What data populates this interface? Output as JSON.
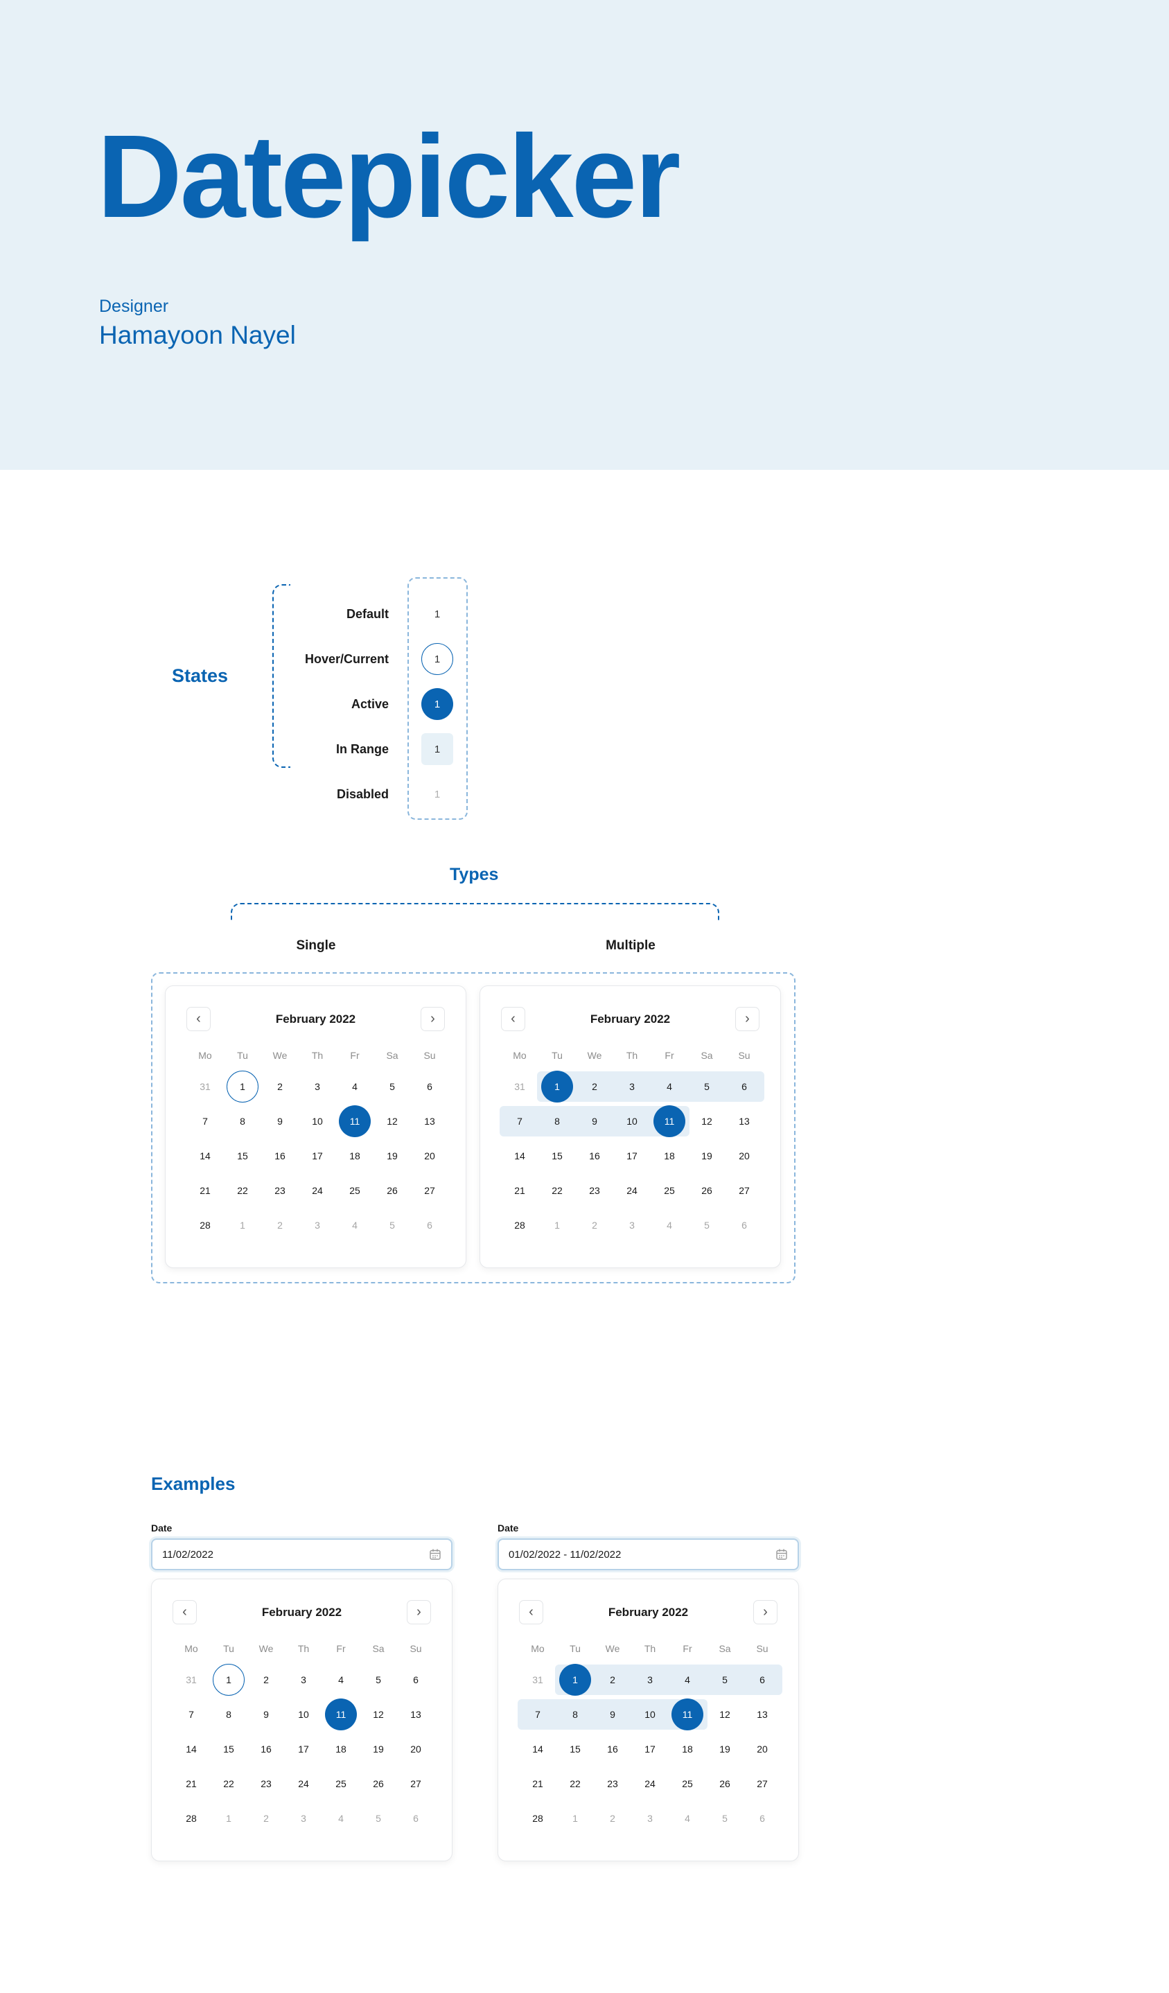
{
  "hero": {
    "title": "Datepicker",
    "designer_label": "Designer",
    "designer_name": "Hamayoon Nayel"
  },
  "colors": {
    "accent": "#0a64b2",
    "hero_bg": "#e7f1f7",
    "range_bg": "#e4eef6",
    "muted_text": "#a5a5a5"
  },
  "states": {
    "title": "States",
    "items": [
      {
        "label": "Default",
        "value": "1",
        "variant": "default"
      },
      {
        "label": "Hover/Current",
        "value": "1",
        "variant": "hover"
      },
      {
        "label": "Active",
        "value": "1",
        "variant": "active"
      },
      {
        "label": "In Range",
        "value": "1",
        "variant": "range"
      },
      {
        "label": "Disabled",
        "value": "1",
        "variant": "disabled"
      }
    ]
  },
  "types": {
    "title": "Types",
    "single_label": "Single",
    "multiple_label": "Multiple"
  },
  "calendar": {
    "month": "February 2022",
    "prev_icon": "chevron-left-icon",
    "next_icon": "chevron-right-icon",
    "weekdays": [
      "Mo",
      "Tu",
      "We",
      "Th",
      "Fr",
      "Sa",
      "Su"
    ],
    "weeks": [
      [
        "31",
        "1",
        "2",
        "3",
        "4",
        "5",
        "6"
      ],
      [
        "7",
        "8",
        "9",
        "10",
        "11",
        "12",
        "13"
      ],
      [
        "14",
        "15",
        "16",
        "17",
        "18",
        "19",
        "20"
      ],
      [
        "21",
        "22",
        "23",
        "24",
        "25",
        "26",
        "27"
      ],
      [
        "28",
        "1",
        "2",
        "3",
        "4",
        "5",
        "6"
      ]
    ],
    "muted": [
      [
        0,
        0
      ],
      [
        4,
        1
      ],
      [
        4,
        2
      ],
      [
        4,
        3
      ],
      [
        4,
        4
      ],
      [
        4,
        5
      ],
      [
        4,
        6
      ]
    ]
  },
  "single": {
    "hover_day": "1",
    "active_day": "11"
  },
  "multiple": {
    "range_start": "1",
    "range_end": "11"
  },
  "examples": {
    "title": "Examples",
    "single": {
      "label": "Date",
      "value": "11/02/2022",
      "icon": "calendar-icon"
    },
    "range": {
      "label": "Date",
      "value": "01/02/2022 - 11/02/2022",
      "icon": "calendar-icon"
    }
  }
}
